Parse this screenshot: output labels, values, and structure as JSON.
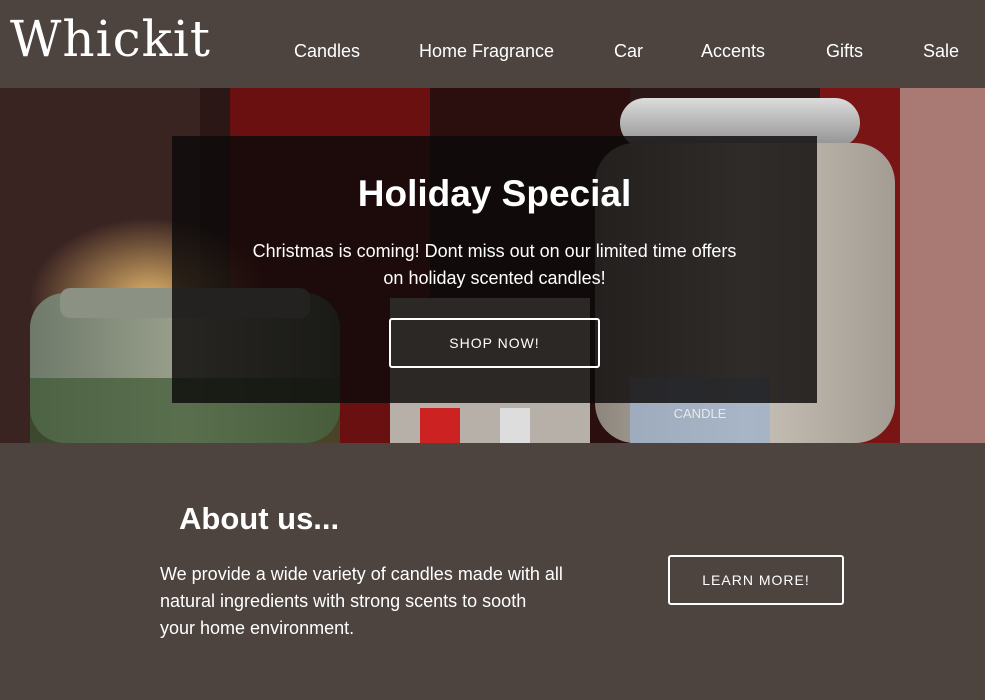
{
  "brand": {
    "logo_text": "Whickit"
  },
  "nav": {
    "items": [
      "Candles",
      "Home Fragrance",
      "Car",
      "Accents",
      "Gifts",
      "Sale"
    ]
  },
  "hero": {
    "title": "Holiday Special",
    "text_line1": "Christmas is coming! Dont miss out on our limited time offers",
    "text_line2": "on holiday scented candles!",
    "cta_label": "SHOP NOW!",
    "jar_label": "CANDLE"
  },
  "about": {
    "title": "About us...",
    "text_line1": "We provide a wide variety of candles made with all",
    "text_line2": "natural ingredients with strong scents to sooth",
    "text_line3": "your home environment.",
    "cta_label": "LEARN MORE!"
  },
  "colors": {
    "header_bg": "#4d433f",
    "page_bg": "#4d433f",
    "overlay_bg": "rgba(12,10,10,0.82)",
    "text": "#ffffff"
  }
}
